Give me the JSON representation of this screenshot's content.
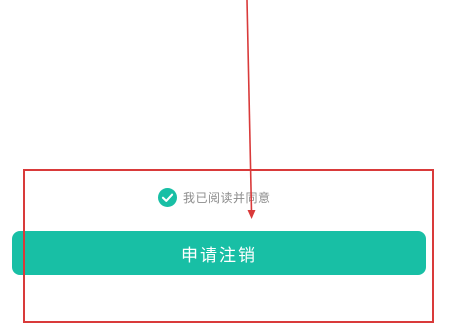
{
  "agreement": {
    "checked": true,
    "label": "我已阅读并同意"
  },
  "apply_button": {
    "label": "申请注销"
  },
  "colors": {
    "accent": "#18bfa5",
    "annotation": "#d93a3a",
    "muted_text": "#8c8c8c"
  },
  "icons": {
    "agree_check": "check-circle-icon"
  }
}
